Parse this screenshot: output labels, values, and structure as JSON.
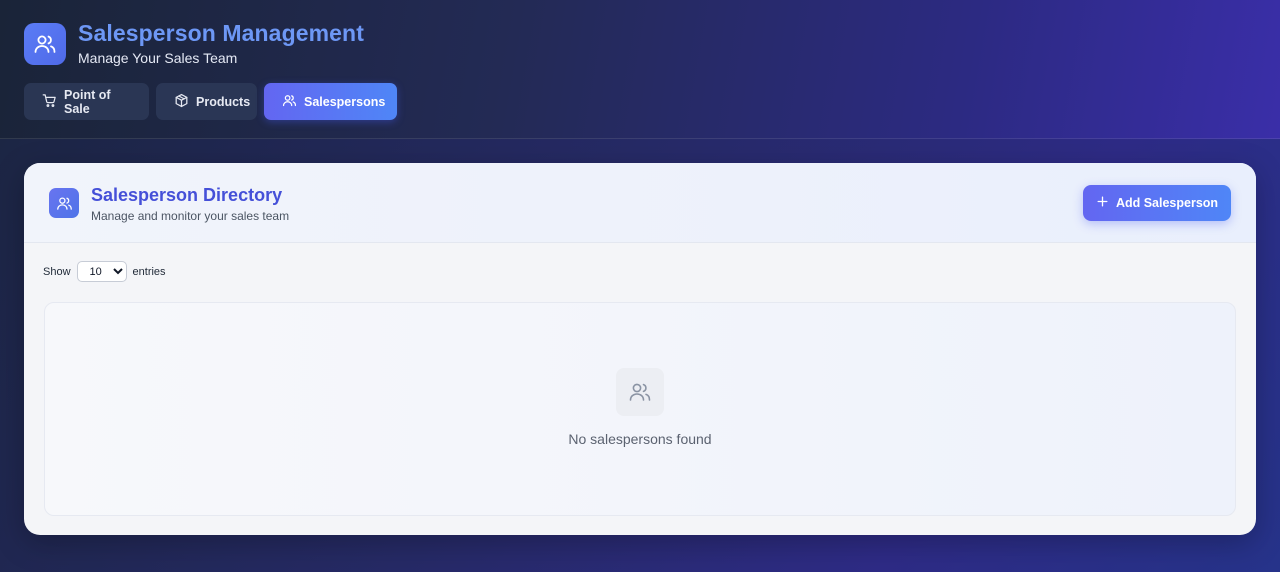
{
  "header": {
    "title": "Salesperson Management",
    "subtitle": "Manage Your Sales Team",
    "icon": "users-icon"
  },
  "nav": {
    "tabs": [
      {
        "label": "Point of Sale",
        "icon": "cart-icon",
        "active": false
      },
      {
        "label": "Products",
        "icon": "box-icon",
        "active": false
      },
      {
        "label": "Salespersons",
        "icon": "users-icon",
        "active": true
      }
    ]
  },
  "directory": {
    "title": "Salesperson Directory",
    "subtitle": "Manage and monitor your sales team",
    "add_button_label": "Add Salesperson"
  },
  "entries": {
    "show_label": "Show",
    "selected": "10",
    "suffix_label": "entries"
  },
  "empty_state": {
    "message": "No salespersons found",
    "icon": "users-icon"
  },
  "colors": {
    "accent": "#6366f1",
    "accent_secondary": "#4f86f7",
    "title_blue": "#4550d8"
  }
}
